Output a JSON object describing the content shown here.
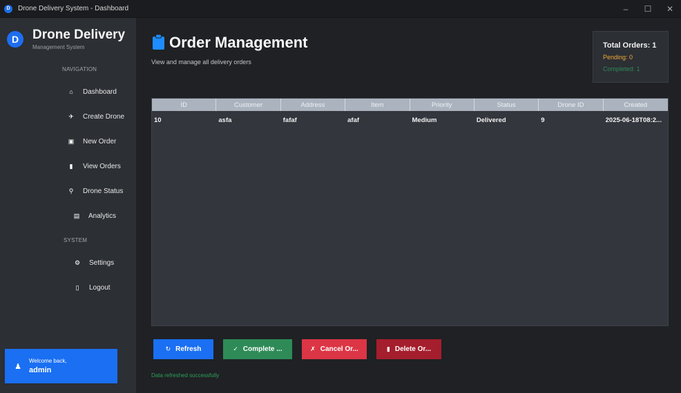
{
  "window": {
    "title": "Drone Delivery System - Dashboard",
    "controls": {
      "minimize": "–",
      "maximize": "☐",
      "close": "✕"
    }
  },
  "sidebar": {
    "logo_letter": "D",
    "brand_name": "Drone Delivery",
    "brand_sub": "Management System",
    "nav_label": "NAVIGATION",
    "system_label": "SYSTEM",
    "nav_items": [
      {
        "label": "Dashboard",
        "icon": "home-icon",
        "glyph": "⌂"
      },
      {
        "label": "Create Drone",
        "icon": "drone-icon",
        "glyph": "✈"
      },
      {
        "label": "New Order",
        "icon": "package-icon",
        "glyph": "▣"
      },
      {
        "label": "View Orders",
        "icon": "clipboard-icon",
        "glyph": "▮"
      },
      {
        "label": "Drone Status",
        "icon": "pin-icon",
        "glyph": "⚲"
      },
      {
        "label": "Analytics",
        "icon": "chart-icon",
        "glyph": "▤"
      }
    ],
    "system_items": [
      {
        "label": "Settings",
        "icon": "gear-icon",
        "glyph": "⚙"
      },
      {
        "label": "Logout",
        "icon": "door-icon",
        "glyph": "▯"
      }
    ],
    "welcome": {
      "line1": "Welcome back,",
      "username": "admin",
      "icon": "user-icon",
      "glyph": "♟"
    }
  },
  "main": {
    "title": "Order Management",
    "subtitle": "View and manage all delivery orders",
    "stats": {
      "total": "Total Orders: 1",
      "pending": "Pending: 0",
      "completed": "Completed: 1"
    },
    "table": {
      "columns": [
        "ID",
        "Customer",
        "Address",
        "Item",
        "Priority",
        "Status",
        "Drone ID",
        "Created"
      ],
      "rows": [
        [
          "10",
          "asfa",
          "fafaf",
          "afaf",
          "Medium",
          "Delivered",
          "9",
          "2025-06-18T08:2..."
        ]
      ]
    },
    "buttons": {
      "refresh": {
        "label": "Refresh",
        "glyph": "↻"
      },
      "complete": {
        "label": "Complete ...",
        "glyph": "✓"
      },
      "cancel": {
        "label": "Cancel Or...",
        "glyph": "✗"
      },
      "delete": {
        "label": "Delete Or...",
        "glyph": "▮"
      }
    },
    "status_message": "Data refreshed successfully"
  },
  "colors": {
    "accent": "#1a6ff2",
    "success": "#2e8b57",
    "warning": "#f0a93a",
    "danger": "#dc3545",
    "danger_dark": "#a51e2d",
    "sidebar_bg": "#2c2f34",
    "main_bg": "#1f2124"
  }
}
